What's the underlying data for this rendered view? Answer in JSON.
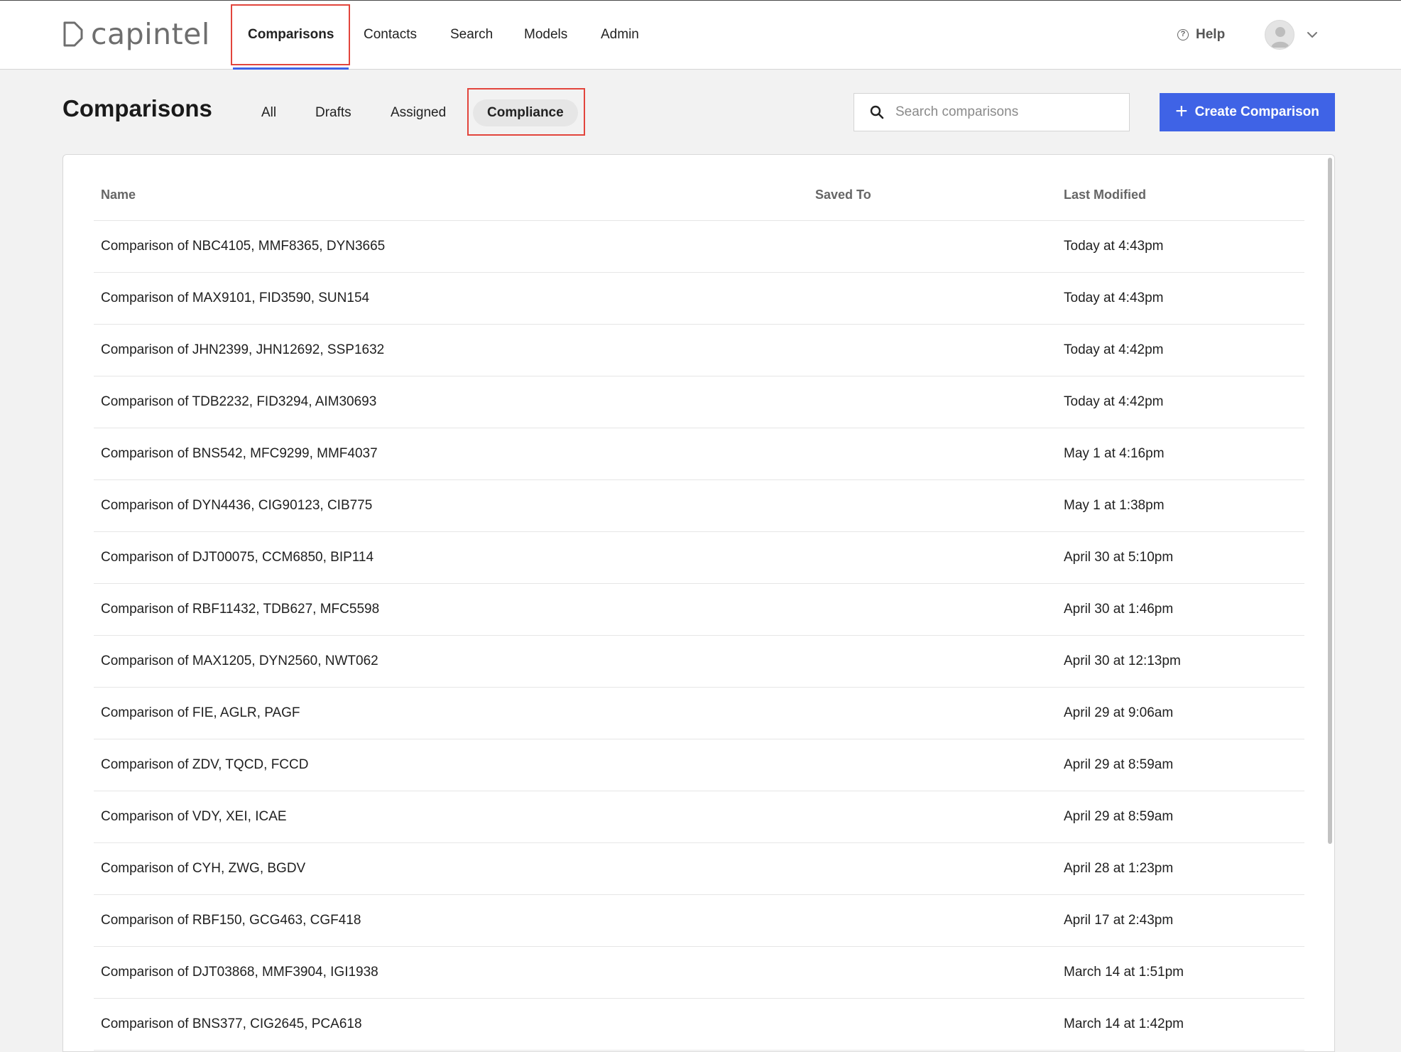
{
  "app": {
    "logo_text": "capintel"
  },
  "nav": {
    "items": [
      {
        "label": "Comparisons",
        "active": true
      },
      {
        "label": "Contacts"
      },
      {
        "label": "Search"
      },
      {
        "label": "Models"
      },
      {
        "label": "Admin"
      }
    ],
    "help_label": "Help",
    "icons": {
      "help": "help-circle-icon",
      "avatar": "user-avatar-icon",
      "menu": "chevron-down-icon"
    }
  },
  "header": {
    "title": "Comparisons",
    "tabs": [
      {
        "label": "All"
      },
      {
        "label": "Drafts"
      },
      {
        "label": "Assigned"
      },
      {
        "label": "Compliance",
        "active": true
      }
    ],
    "search_placeholder": "Search comparisons",
    "create_label": "Create Comparison"
  },
  "colors": {
    "accent": "#3f63e6",
    "highlight": "#e2453c"
  },
  "table": {
    "columns": [
      "Name",
      "Saved To",
      "Last Modified"
    ],
    "rows": [
      {
        "name": "Comparison of NBC4105, MMF8365, DYN3665",
        "saved_to": "",
        "modified": "Today at 4:43pm"
      },
      {
        "name": "Comparison of MAX9101, FID3590, SUN154",
        "saved_to": "",
        "modified": "Today at 4:43pm"
      },
      {
        "name": "Comparison of JHN2399, JHN12692, SSP1632",
        "saved_to": "",
        "modified": "Today at 4:42pm"
      },
      {
        "name": "Comparison of TDB2232, FID3294, AIM30693",
        "saved_to": "",
        "modified": "Today at 4:42pm"
      },
      {
        "name": "Comparison of BNS542, MFC9299, MMF4037",
        "saved_to": "",
        "modified": "May 1 at 4:16pm"
      },
      {
        "name": "Comparison of DYN4436, CIG90123, CIB775",
        "saved_to": "",
        "modified": "May 1 at 1:38pm"
      },
      {
        "name": "Comparison of DJT00075, CCM6850, BIP114",
        "saved_to": "",
        "modified": "April 30 at 5:10pm"
      },
      {
        "name": "Comparison of RBF11432, TDB627, MFC5598",
        "saved_to": "",
        "modified": "April 30 at 1:46pm"
      },
      {
        "name": "Comparison of MAX1205, DYN2560, NWT062",
        "saved_to": "",
        "modified": "April 30 at 12:13pm"
      },
      {
        "name": "Comparison of FIE, AGLR, PAGF",
        "saved_to": "",
        "modified": "April 29 at 9:06am"
      },
      {
        "name": "Comparison of ZDV, TQCD, FCCD",
        "saved_to": "",
        "modified": "April 29 at 8:59am"
      },
      {
        "name": "Comparison of VDY, XEI, ICAE",
        "saved_to": "",
        "modified": "April 29 at 8:59am"
      },
      {
        "name": "Comparison of CYH, ZWG, BGDV",
        "saved_to": "",
        "modified": "April 28 at 1:23pm"
      },
      {
        "name": "Comparison of RBF150, GCG463, CGF418",
        "saved_to": "",
        "modified": "April 17 at 2:43pm"
      },
      {
        "name": "Comparison of DJT03868, MMF3904, IGI1938",
        "saved_to": "",
        "modified": "March 14 at 1:51pm"
      },
      {
        "name": "Comparison of BNS377, CIG2645, PCA618",
        "saved_to": "",
        "modified": "March 14 at 1:42pm"
      }
    ]
  }
}
